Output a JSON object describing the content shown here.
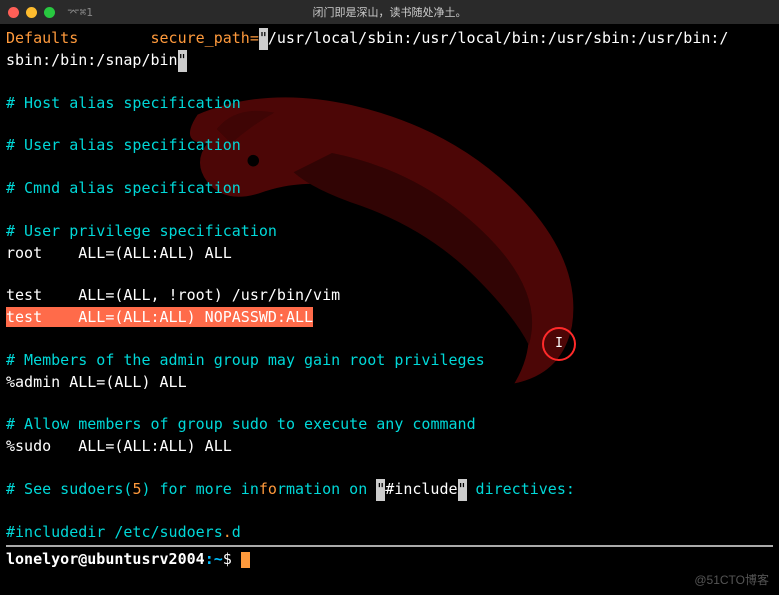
{
  "titlebar": {
    "tab": "⌤⌘1",
    "title": "闭门即是深山，读书随处净土。"
  },
  "lines": {
    "l0a": "Defaults        secure_path=",
    "l0b": "/usr/local/sbin:/usr/local/bin:/usr/sbin:/usr/bin:/",
    "l1a": "sbin:/bin:/snap/bin",
    "l3": "# Host alias specification",
    "l5": "# User alias specification",
    "l7": "# Cmnd alias specification",
    "l9": "# User privilege specification",
    "l10": "root    ALL=(ALL:ALL) ALL",
    "l12": "test    ALL=(ALL, !root) /usr/bin/vim",
    "l13": "test    ALL=(ALL:ALL) NOPASSWD:ALL",
    "l15": "# Members of the admin group may gain root privileges",
    "l16": "%admin ALL=(ALL) ALL",
    "l18": "# Allow members of group sudo to execute any command",
    "l19": "%sudo   ALL=(ALL:ALL) ALL",
    "l21a": "# See sudoers(",
    "l21b": "5",
    "l21c": ") for more in",
    "l21d": "fo",
    "l21e": "rmation on ",
    "l21f": "#include",
    "l21g": " directives:",
    "l23a": "#includedir /etc/sudoers",
    "l23b": ".",
    "l23c": "d"
  },
  "prompt": {
    "user": "lonelyor",
    "at": "@",
    "host": "ubuntusrv2004",
    "colon": ":",
    "path": "~",
    "dollar": "$ "
  },
  "watermark": "@51CTO博客",
  "quote": "\""
}
